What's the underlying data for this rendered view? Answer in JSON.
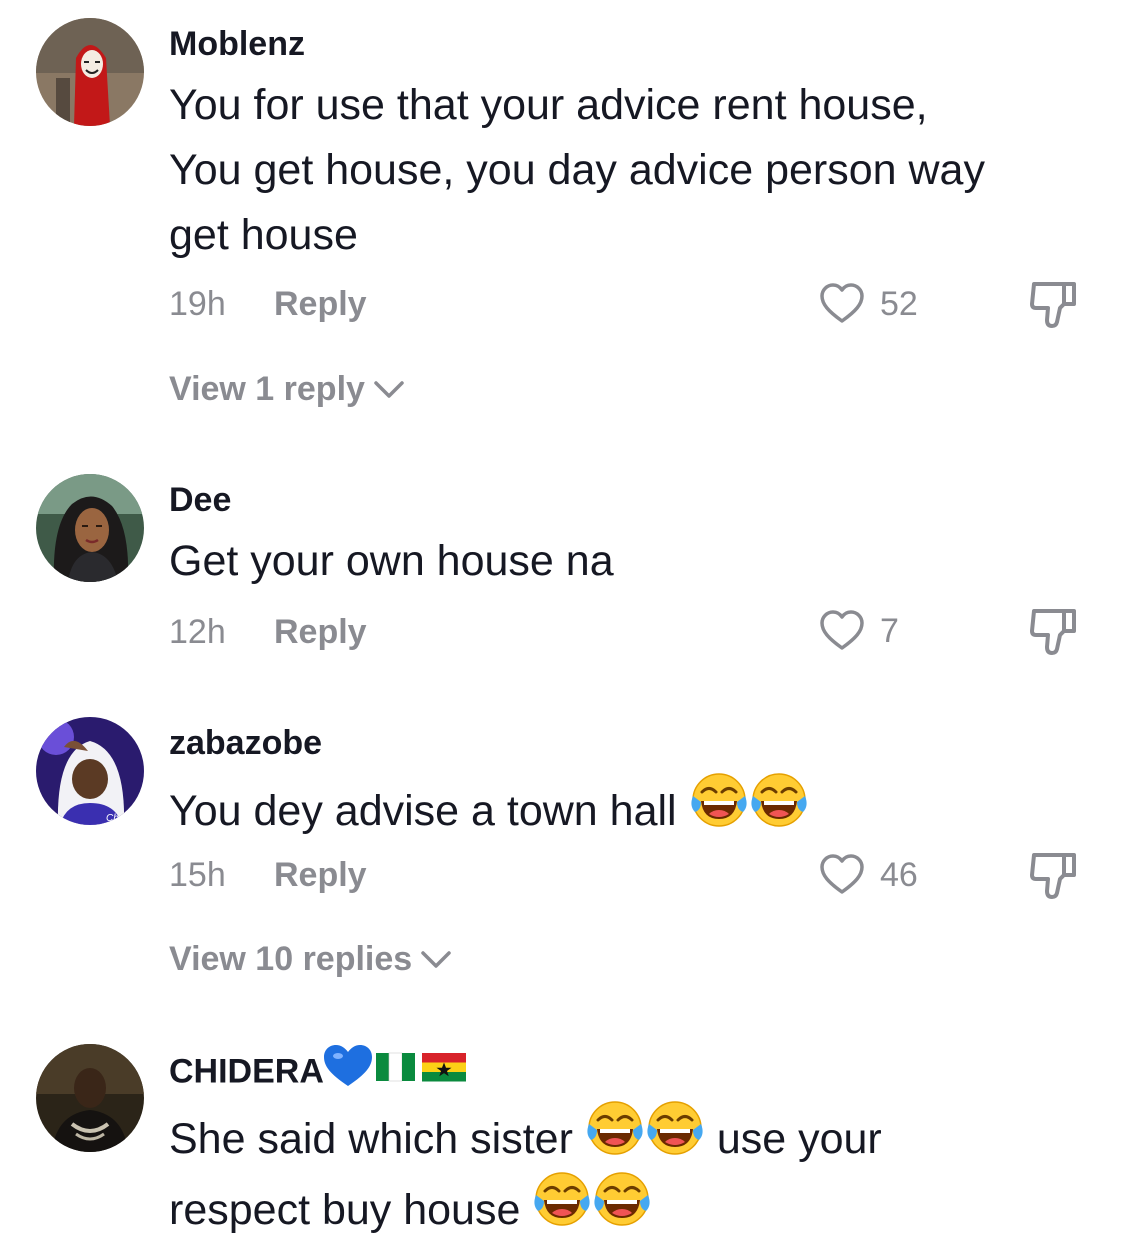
{
  "comments": [
    {
      "username": "Moblenz",
      "text_lines": [
        "You for use that your advice rent house,",
        "You get house, you day advice person way",
        "get house"
      ],
      "time": "19h",
      "reply_label": "Reply",
      "likes": "52",
      "view_replies": "View 1 reply"
    },
    {
      "username": "Dee",
      "text": "Get your own house na",
      "time": "12h",
      "reply_label": "Reply",
      "likes": "7"
    },
    {
      "username": "zabazobe",
      "text": "You dey advise a town hall",
      "emojis": [
        "face-with-tears-of-joy",
        "face-with-tears-of-joy"
      ],
      "time": "15h",
      "reply_label": "Reply",
      "likes": "46",
      "view_replies": "View 10 replies"
    },
    {
      "username": "CHIDERA",
      "username_icons": [
        "blue-heart",
        "nigeria-flag",
        "ghana-flag"
      ],
      "text_line1_a": "She said which sister",
      "text_line1_b": "use your",
      "text_line2": "respect buy house",
      "emojis": [
        "face-with-tears-of-joy",
        "face-with-tears-of-joy"
      ]
    }
  ],
  "colors": {
    "text_primary": "#161823",
    "text_secondary": "#8a8b91",
    "background": "#ffffff"
  }
}
